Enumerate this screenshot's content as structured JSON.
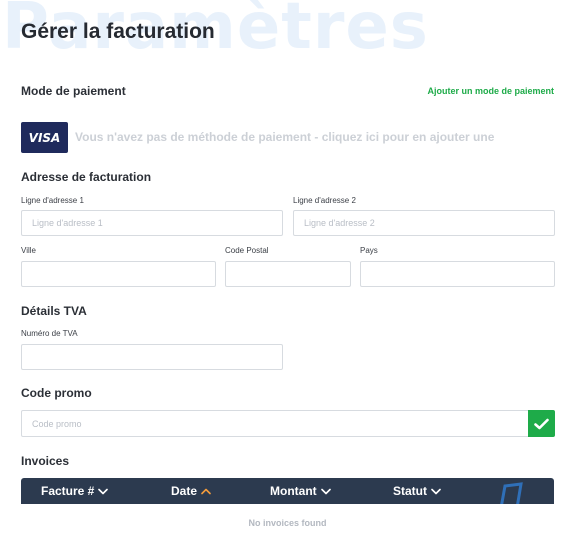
{
  "watermark": "Paramètres",
  "page_title": "Gérer la facturation",
  "payment": {
    "section_title": "Mode de paiement",
    "add_link": "Ajouter un mode de paiement",
    "card_brand": "VISA",
    "empty_text": "Vous n'avez pas de méthode de paiement - cliquez ici pour en ajouter une"
  },
  "billing_address": {
    "section_title": "Adresse de facturation",
    "address1": {
      "label": "Ligne d'adresse 1",
      "placeholder": "Ligne d'adresse 1",
      "value": ""
    },
    "address2": {
      "label": "Ligne d'adresse 2",
      "placeholder": "Ligne d'adresse 2",
      "value": ""
    },
    "city": {
      "label": "Ville",
      "placeholder": "",
      "value": ""
    },
    "postal_code": {
      "label": "Code Postal",
      "placeholder": "",
      "value": ""
    },
    "country": {
      "label": "Pays",
      "placeholder": "",
      "value": ""
    }
  },
  "vat": {
    "section_title": "Détails TVA",
    "number": {
      "label": "Numéro de TVA",
      "placeholder": "",
      "value": ""
    }
  },
  "promo": {
    "section_title": "Code promo",
    "placeholder": "Code promo",
    "value": ""
  },
  "invoices": {
    "section_title": "Invoices",
    "columns": [
      {
        "label": "Facture #",
        "sort_icon": "chevron-down-icon"
      },
      {
        "label": "Date",
        "sort_icon": "chevron-up-icon"
      },
      {
        "label": "Montant",
        "sort_icon": "chevron-down-icon"
      },
      {
        "label": "Statut",
        "sort_icon": "chevron-down-icon"
      }
    ],
    "empty_text": "No invoices found"
  },
  "colors": {
    "accent_green": "#1eab49",
    "table_header_bg": "#2c3a4f",
    "visa_bg": "#1f2a5c",
    "active_sort": "#f39c3c",
    "watermark": "#e8f1fb"
  }
}
